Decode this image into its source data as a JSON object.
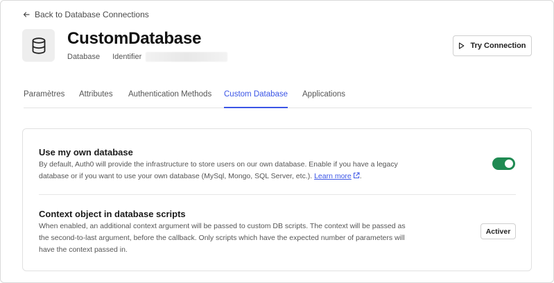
{
  "back_link": {
    "label": "Back to Database Connections",
    "icon": "arrow-left-icon"
  },
  "header": {
    "title": "CustomDatabase",
    "type_label": "Database",
    "identifier_label": "Identifier",
    "icon": "database-icon"
  },
  "actions": {
    "try_connection_label": "Try Connection",
    "try_icon": "play-icon"
  },
  "tabs": [
    {
      "label": "Paramètres",
      "active": false
    },
    {
      "label": "Attributes",
      "active": false
    },
    {
      "label": "Authentication Methods",
      "active": false
    },
    {
      "label": "Custom Database",
      "active": true
    },
    {
      "label": "Applications",
      "active": false
    }
  ],
  "sections": {
    "own_db": {
      "title": "Use my own database",
      "description": "By default, Auth0 will provide the infrastructure to store users on our own database. Enable if you have a legacy database or if you want to use your own database (MySql, Mongo, SQL Server, etc.).",
      "link_label": "Learn more",
      "toggle_on": true
    },
    "context": {
      "title": "Context object in database scripts",
      "description": "When enabled, an additional context argument will be passed to custom DB scripts. The context will be passed as the second-to-last argument, before the callback. Only scripts which have the expected number of parameters will have the context passed in.",
      "button_label": "Activer"
    }
  },
  "colors": {
    "accent": "#3b55e6",
    "toggle_on": "#1f8a52"
  }
}
